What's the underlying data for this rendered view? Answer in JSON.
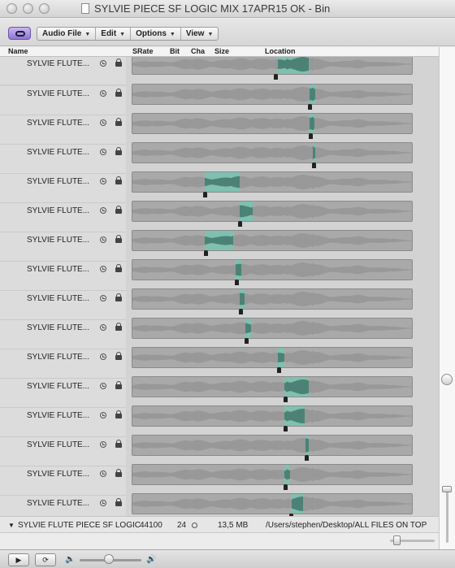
{
  "window": {
    "title": "SYLVIE PIECE SF LOGIC MIX 17APR15 OK - Bin"
  },
  "toolbar": {
    "link_icon": "link-icon",
    "menus": [
      {
        "label": "Audio File"
      },
      {
        "label": "Edit"
      },
      {
        "label": "Options"
      },
      {
        "label": "View"
      }
    ]
  },
  "columns": {
    "name": "Name",
    "srate": "SRate",
    "bit": "Bit",
    "cha": "Cha",
    "size": "Size",
    "location": "Location"
  },
  "regions": [
    {
      "name": "SYLVIE FLUTE...",
      "sel_start": 0.52,
      "sel_end": 0.63,
      "anchor": 0.51
    },
    {
      "name": "SYLVIE FLUTE...",
      "sel_start": 0.635,
      "sel_end": 0.655,
      "anchor": 0.63
    },
    {
      "name": "SYLVIE FLUTE...",
      "sel_start": 0.635,
      "sel_end": 0.65,
      "anchor": 0.635
    },
    {
      "name": "SYLVIE FLUTE...",
      "sel_start": 0.645,
      "sel_end": 0.655,
      "anchor": 0.645
    },
    {
      "name": "SYLVIE FLUTE...",
      "sel_start": 0.26,
      "sel_end": 0.385,
      "anchor": 0.255
    },
    {
      "name": "SYLVIE FLUTE...",
      "sel_start": 0.385,
      "sel_end": 0.43,
      "anchor": 0.38
    },
    {
      "name": "SYLVIE FLUTE...",
      "sel_start": 0.26,
      "sel_end": 0.36,
      "anchor": 0.26
    },
    {
      "name": "SYLVIE FLUTE...",
      "sel_start": 0.37,
      "sel_end": 0.39,
      "anchor": 0.37
    },
    {
      "name": "SYLVIE FLUTE...",
      "sel_start": 0.385,
      "sel_end": 0.4,
      "anchor": 0.385
    },
    {
      "name": "SYLVIE FLUTE...",
      "sel_start": 0.405,
      "sel_end": 0.425,
      "anchor": 0.405
    },
    {
      "name": "SYLVIE FLUTE...",
      "sel_start": 0.52,
      "sel_end": 0.545,
      "anchor": 0.52
    },
    {
      "name": "SYLVIE FLUTE...",
      "sel_start": 0.545,
      "sel_end": 0.63,
      "anchor": 0.545
    },
    {
      "name": "SYLVIE FLUTE...",
      "sel_start": 0.545,
      "sel_end": 0.615,
      "anchor": 0.545
    },
    {
      "name": "SYLVIE FLUTE...",
      "sel_start": 0.62,
      "sel_end": 0.63,
      "anchor": 0.62
    },
    {
      "name": "SYLVIE FLUTE...",
      "sel_start": 0.545,
      "sel_end": 0.565,
      "anchor": 0.545
    },
    {
      "name": "SYLVIE FLUTE...",
      "sel_start": 0.57,
      "sel_end": 0.61,
      "anchor": 0.565
    }
  ],
  "summary": {
    "name": "SYLVIE FLUTE PIECE SF LOGIC",
    "srate": "44100",
    "bit": "24",
    "size": "13,5 MB",
    "location": "/Users/stephen/Desktop/ALL FILES ON TOP"
  },
  "icons": {
    "clock": "clock-icon",
    "lock": "lock-icon",
    "speaker_low": "speaker-low-icon",
    "speaker_high": "speaker-high-icon",
    "play": "play-icon",
    "loop": "loop-icon"
  },
  "colors": {
    "selection": "#7fc0b0",
    "selection_wave": "#2a5a50",
    "waveform": "#8e8e8e",
    "link_accent": "#8f74d4"
  }
}
